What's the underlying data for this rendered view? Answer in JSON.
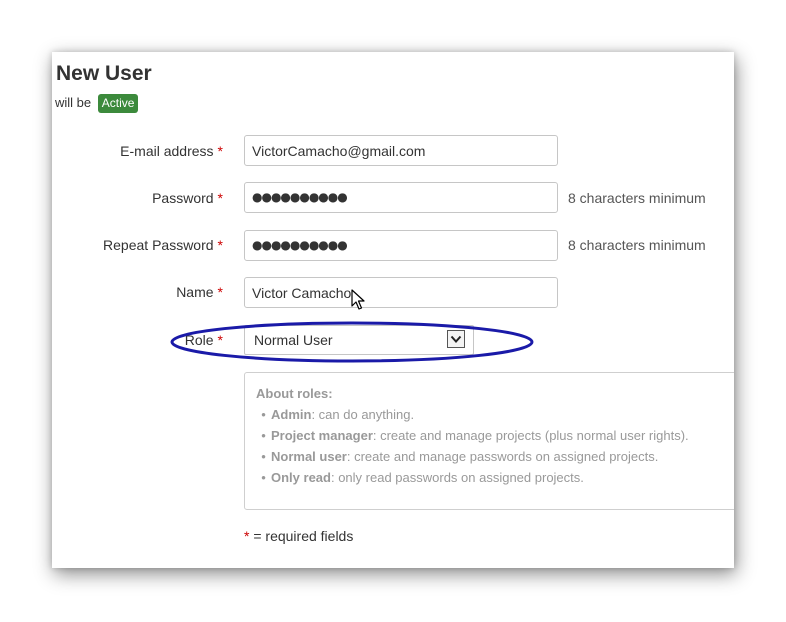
{
  "page": {
    "title": "New User",
    "status_prefix": "will be",
    "status_badge": "Active"
  },
  "form": {
    "email": {
      "label": "E-mail address",
      "required": "*",
      "value": "VictorCamacho@gmail.com"
    },
    "password": {
      "label": "Password",
      "required": "*",
      "masked_value": "●●●●●●●●●●",
      "hint": "8 characters minimum"
    },
    "repeat_password": {
      "label": "Repeat Password",
      "required": "*",
      "masked_value": "●●●●●●●●●●",
      "hint": "8 characters minimum"
    },
    "name": {
      "label": "Name",
      "required": "*",
      "value": "Victor Camacho"
    },
    "role": {
      "label": "Role",
      "required": "*",
      "selected": "Normal User"
    }
  },
  "about_roles": {
    "title": "About roles:",
    "items": [
      {
        "role": "Admin",
        "desc": ": can do anything."
      },
      {
        "role": "Project manager",
        "desc": ": create and manage projects (plus normal user rights)."
      },
      {
        "role": "Normal user",
        "desc": ": create and manage passwords on assigned projects."
      },
      {
        "role": "Only read",
        "desc": ": only read passwords on assigned projects."
      }
    ]
  },
  "footer": {
    "required_mark": "*",
    "required_note": " = required fields"
  },
  "colors": {
    "badge": "#3c8a3c",
    "required": "#cc0000",
    "highlight": "#1a1aa8"
  },
  "icons": {
    "select_arrow": "chevron-down-icon",
    "cursor": "mouse-pointer-icon"
  }
}
